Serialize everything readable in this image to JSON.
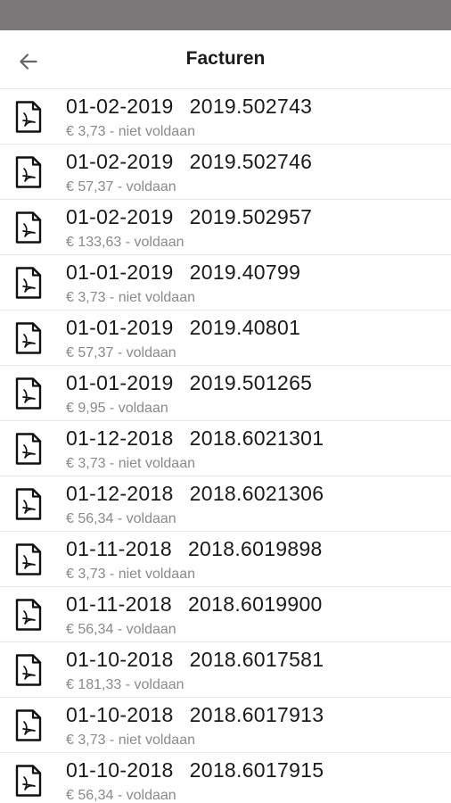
{
  "header": {
    "title": "Facturen",
    "back_icon": "arrow-left-icon"
  },
  "invoices": [
    {
      "date": "01-02-2019",
      "number": "2019.502743",
      "amount": "€ 3,73",
      "status": "niet voldaan"
    },
    {
      "date": "01-02-2019",
      "number": "2019.502746",
      "amount": "€ 57,37",
      "status": "voldaan"
    },
    {
      "date": "01-02-2019",
      "number": "2019.502957",
      "amount": "€ 133,63",
      "status": "voldaan"
    },
    {
      "date": "01-01-2019",
      "number": "2019.40799",
      "amount": "€ 3,73",
      "status": "niet voldaan"
    },
    {
      "date": "01-01-2019",
      "number": "2019.40801",
      "amount": "€ 57,37",
      "status": "voldaan"
    },
    {
      "date": "01-01-2019",
      "number": "2019.501265",
      "amount": "€ 9,95",
      "status": "voldaan"
    },
    {
      "date": "01-12-2018",
      "number": "2018.6021301",
      "amount": "€ 3,73",
      "status": "niet voldaan"
    },
    {
      "date": "01-12-2018",
      "number": "2018.6021306",
      "amount": "€ 56,34",
      "status": "voldaan"
    },
    {
      "date": "01-11-2018",
      "number": "2018.6019898",
      "amount": "€ 3,73",
      "status": "niet voldaan"
    },
    {
      "date": "01-11-2018",
      "number": "2018.6019900",
      "amount": "€ 56,34",
      "status": "voldaan"
    },
    {
      "date": "01-10-2018",
      "number": "2018.6017581",
      "amount": "€ 181,33",
      "status": "voldaan"
    },
    {
      "date": "01-10-2018",
      "number": "2018.6017913",
      "amount": "€ 3,73",
      "status": "niet voldaan"
    },
    {
      "date": "01-10-2018",
      "number": "2018.6017915",
      "amount": "€ 56,34",
      "status": "voldaan"
    }
  ],
  "icons": {
    "invoice": "pdf-file-icon"
  },
  "colors": {
    "status_bar": "#7a7878",
    "primary_text": "#1a1a1a",
    "secondary_text": "#8a8a8a",
    "divider": "#e8e8e8"
  }
}
